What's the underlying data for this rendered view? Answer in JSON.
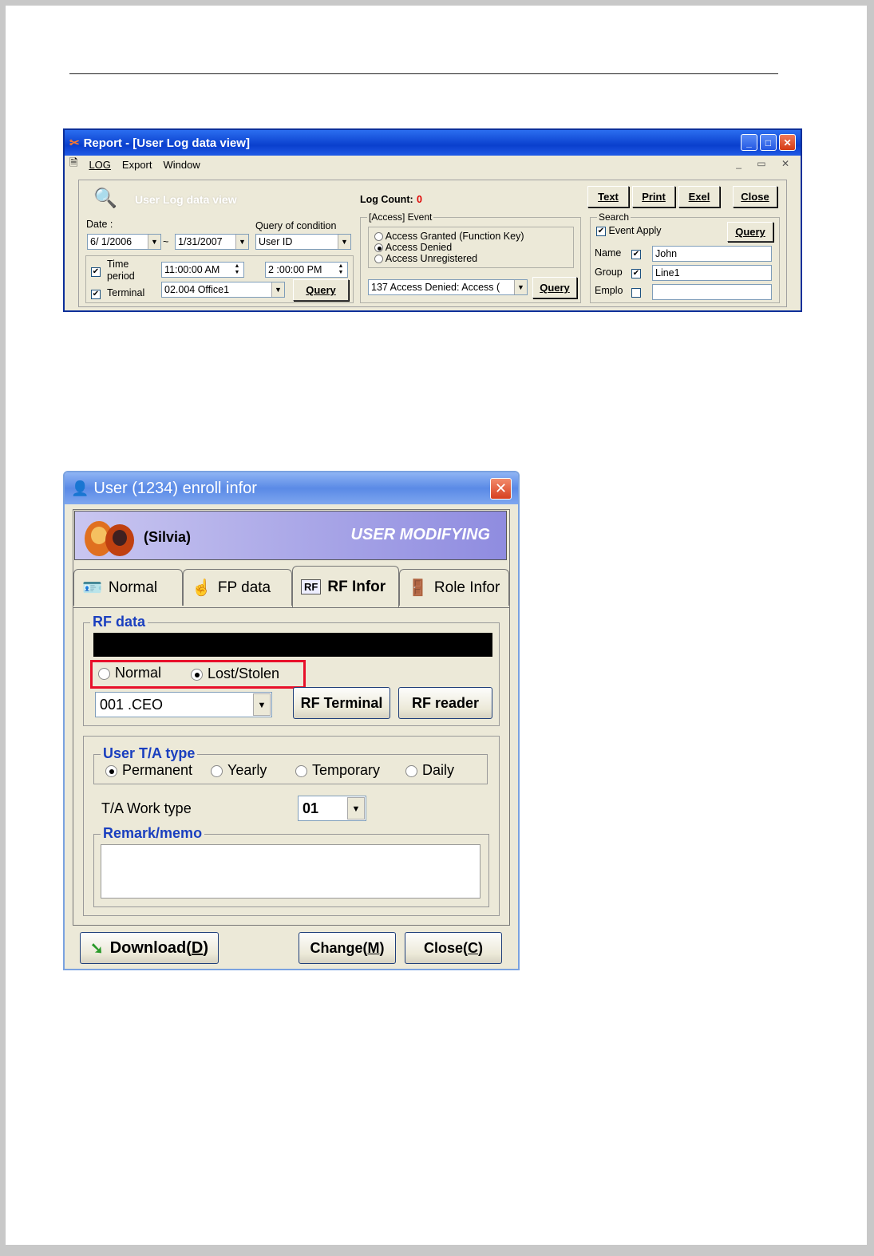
{
  "report": {
    "title": "Report - [User Log data view]",
    "menu": [
      "LOG",
      "Export",
      "Window"
    ],
    "view_title": "User Log data view",
    "log_count_label": "Log Count:",
    "log_count_value": "0",
    "buttons": {
      "text": "Text",
      "print": "Print",
      "excel": "Exel",
      "close": "Close"
    },
    "date_label": "Date :",
    "date_from": "6/ 1/2006",
    "date_tilde": "~",
    "date_to": "1/31/2007",
    "query_condition_label": "Query of condition",
    "query_condition_value": "User ID",
    "time_period_label": "Time period",
    "time_from": "11:00:00 AM",
    "time_to": "2 :00:00 PM",
    "terminal_label": "Terminal",
    "terminal_value": "02.004 Office1",
    "query_button": "Query",
    "event_group_label": "[Access] Event",
    "event_options": [
      "Access Granted (Function Key)",
      "Access Denied",
      "Access Unregistered"
    ],
    "event_selected_index": 1,
    "event_combo_value": "137 Access Denied: Access (",
    "event_query_button": "Query",
    "search_group_label": "Search",
    "event_apply_label": "Event Apply",
    "search_query_button": "Query",
    "name_label": "Name",
    "name_value": "John",
    "group_label": "Group",
    "group_value": "Line1",
    "emplo_label": "Emplo",
    "emplo_value": ""
  },
  "enroll": {
    "title": "User (1234) enroll infor",
    "user_name": "(Silvia)",
    "mode": "USER MODIFYING",
    "tabs": [
      {
        "label": "Normal",
        "icon": "id-card-icon"
      },
      {
        "label": "FP data",
        "icon": "hand-icon"
      },
      {
        "label": "RF Infor",
        "icon": "rf-card-icon"
      },
      {
        "label": "Role Infor",
        "icon": "exit-door-icon"
      }
    ],
    "active_tab": 2,
    "rf_data_label": "RF data",
    "rf_normal_label": "Normal",
    "rf_lost_label": "Lost/Stolen",
    "rf_selected": "Lost/Stolen",
    "rf_combo_value": "001 .CEO",
    "rf_terminal_button": "RF Terminal",
    "rf_reader_button": "RF reader",
    "ta_type_label": "User T/A type",
    "ta_options": [
      "Permanent",
      "Yearly",
      "Temporary",
      "Daily"
    ],
    "ta_selected": "Permanent",
    "work_type_label": "T/A Work type",
    "work_type_value": "01",
    "remark_label": "Remark/memo",
    "download_button": "Download(",
    "download_key": "D",
    "change_button": "Change(",
    "change_key": "M",
    "close_button": "Close(",
    "close_key": "C",
    "button_suffix": ")"
  },
  "colors": {
    "xp_title_blue": "#0a3fcd",
    "log_count_red": "#e00000",
    "highlight_red": "#e8102a",
    "group_label_blue": "#1a3fbf"
  }
}
